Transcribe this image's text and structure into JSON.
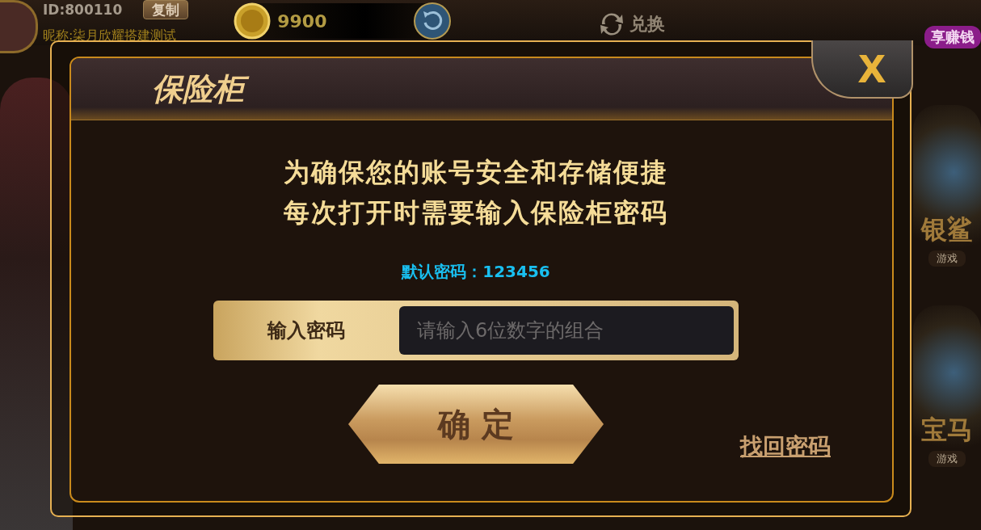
{
  "top_bar": {
    "user_id": "ID:800110",
    "copy_button": "复制",
    "nickname": "昵称:柒月欣耀搭建测试",
    "coins": "9900",
    "exchange": "兑换",
    "promo_badge": "享赚钱"
  },
  "game_tiles": [
    {
      "name": "银鲨",
      "action": "游戏"
    },
    {
      "name": "宝马",
      "action": "游戏"
    }
  ],
  "dialog": {
    "title": "保险柜",
    "message_lines": [
      "为确保您的账号安全和存储便捷",
      "每次打开时需要输入保险柜密码"
    ],
    "default_password": "默认密码：123456",
    "password_field": {
      "label": "输入密码",
      "placeholder": "请输入6位数字的组合"
    },
    "confirm_button": "确 定",
    "recover_link": "找回密码"
  }
}
